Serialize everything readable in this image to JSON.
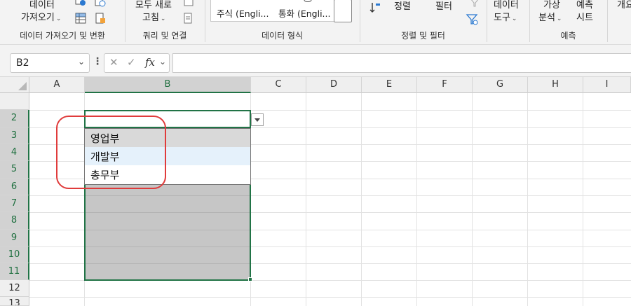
{
  "ribbon": {
    "get_data": {
      "line1": "데이터",
      "line2": "가져오기"
    },
    "refresh_all": {
      "line1": "모두 새로",
      "line2": "고침"
    },
    "groups": {
      "get_transform": "데이터 가져오기 및 변환",
      "queries": "쿼리 및 연결",
      "data_types": "데이터 형식",
      "sort_filter": "정렬 및 필터",
      "forecast": "예측"
    },
    "data_types": {
      "stocks": "주식 (Engli...",
      "currencies": "통화 (Engli..."
    },
    "sort": "정렬",
    "filter": "필터",
    "data_tools": {
      "line1": "데이터",
      "line2": "도구"
    },
    "what_if": {
      "line1": "가상",
      "line2": "분석"
    },
    "forecast_sheet": {
      "line1": "예측",
      "line2": "시트"
    },
    "outline_partial": "개요"
  },
  "formula_bar": {
    "name_box": "B2",
    "cancel": "✕",
    "enter": "✓",
    "fx": "fx",
    "formula": ""
  },
  "grid": {
    "columns": [
      "A",
      "B",
      "C",
      "D",
      "E",
      "F",
      "G",
      "H",
      "I"
    ],
    "rows": [
      "2",
      "3",
      "4",
      "5",
      "6",
      "7",
      "8",
      "9",
      "10",
      "11",
      "12",
      "13"
    ],
    "selected_column": "B",
    "active_cell": "B2"
  },
  "dropdown": {
    "items": [
      "영업부",
      "개발부",
      "총무부"
    ]
  },
  "colors": {
    "accent": "#217346",
    "highlight": "#e03b3b",
    "selection": "#c6c6c6"
  }
}
